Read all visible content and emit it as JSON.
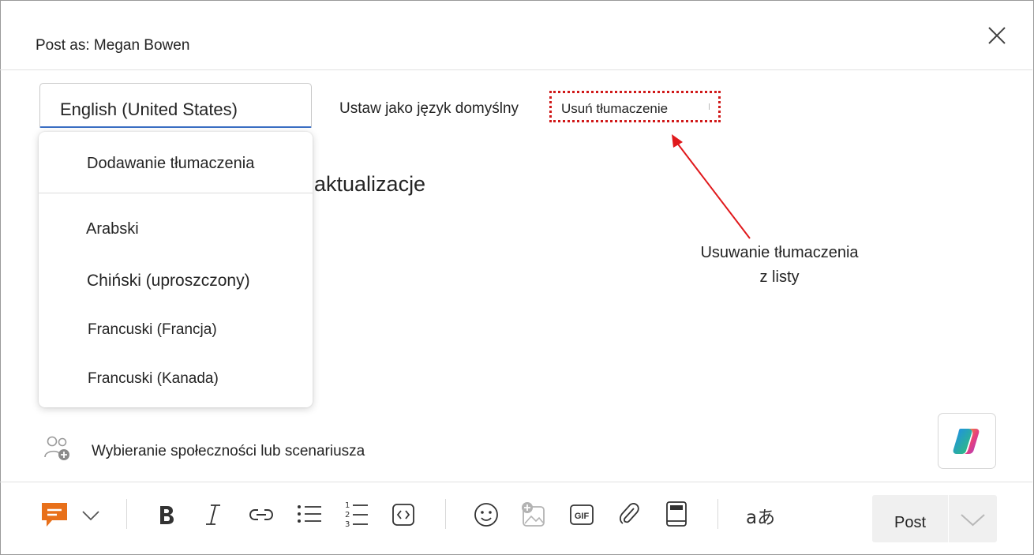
{
  "header": {
    "title": "Post as: Megan Bowen"
  },
  "language_select": {
    "value": "English (United States)"
  },
  "actions": {
    "set_default": "Ustaw jako język domyślny",
    "remove_translation": "Usuń tłumaczenie"
  },
  "dropdown": {
    "add_translation": "Dodawanie tłumaczenia",
    "languages": [
      "Arabski",
      "Chiński (uproszczony)",
      "Francuski (Francja)",
      "Francuski (Kanada)"
    ]
  },
  "background_text": "aktualizacje",
  "annotation": {
    "line1": "Usuwanie tłumaczenia",
    "line2": "z listy",
    "arrow_color": "#e0191c"
  },
  "community": {
    "label": "Wybieranie społeczności lub scenariusza"
  },
  "toolbar": {
    "gif_label": "GIF",
    "translate_glyph": "aあ",
    "post_label": "Post",
    "icons": [
      "message-type-icon",
      "chevron-down-icon",
      "bold-icon",
      "italic-icon",
      "link-icon",
      "bullet-list-icon",
      "numbered-list-icon",
      "code-icon",
      "emoji-icon",
      "image-add-icon",
      "gif-icon",
      "attach-icon",
      "book-icon",
      "translate-icon"
    ]
  },
  "colors": {
    "accent": "#3b6fc4",
    "highlight_border": "#d01818",
    "message_icon": "#e8701a"
  }
}
